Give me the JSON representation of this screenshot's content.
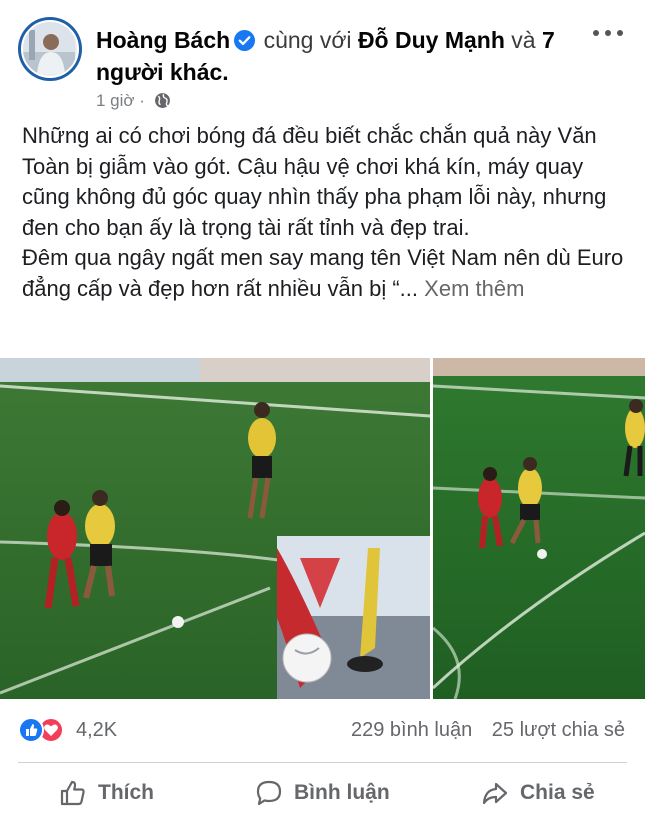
{
  "post": {
    "author": "Hoàng Bách",
    "with_text": "cùng với",
    "tagged": "Đỗ Duy Mạnh",
    "and_text": "và",
    "others": "7 người khác.",
    "time": "1 giờ",
    "separator": "·",
    "body_p1": "Những ai có chơi bóng đá đều biết chắc chắn quả này Văn Toàn bị giẫm vào gót. Cậu hậu vệ chơi khá kín, máy quay cũng không đủ góc quay nhìn thấy pha phạm lỗi này, nhưng đen cho bạn ấy là trọng tài rất tỉnh và đẹp trai.",
    "body_p2": "Đêm qua ngây ngất men say mang tên Việt Nam nên dù Euro đẳng cấp và đẹp hơn rất nhiều vẫn bị “...",
    "see_more": "Xem thêm"
  },
  "stats": {
    "reaction_count": "4,2K",
    "comments": "229 bình luận",
    "shares": "25 lượt chia sẻ"
  },
  "actions": {
    "like": "Thích",
    "comment": "Bình luận",
    "share": "Chia sẻ"
  },
  "icons": [
    "verified-icon",
    "more-icon",
    "globe-icon",
    "like-reaction-icon",
    "love-reaction-icon",
    "thumbs-up-icon",
    "comment-icon",
    "share-icon"
  ],
  "colors": {
    "verified": "#1877f2",
    "like": "#1877f2",
    "love": "#f33e58",
    "muted": "#65676b",
    "pitch": "#2f6b2b"
  }
}
